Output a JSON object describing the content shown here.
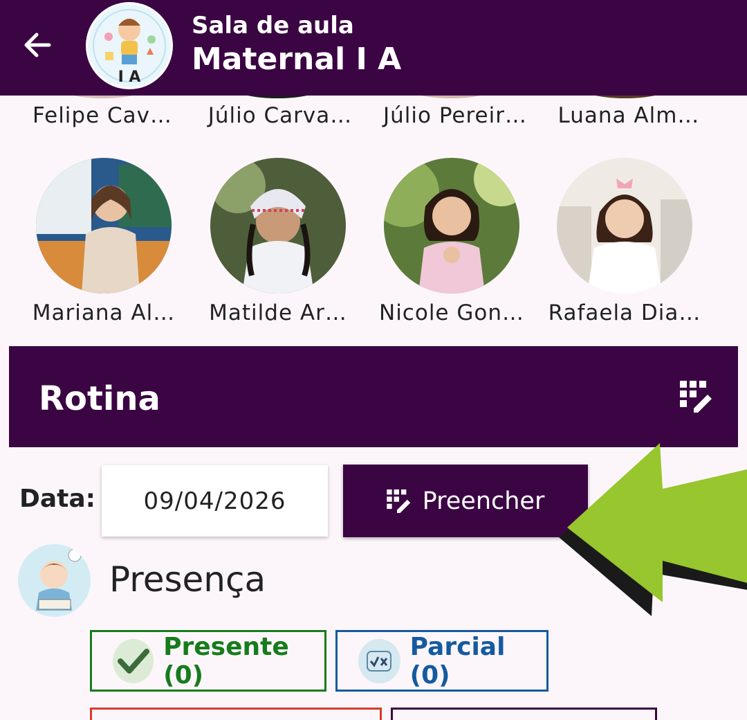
{
  "header": {
    "subtitle": "Sala de aula",
    "title": "Maternal I A",
    "avatar_text": "I A"
  },
  "students_top_row": [
    {
      "name": "Felipe Cav…"
    },
    {
      "name": "Júlio Carva…"
    },
    {
      "name": "Júlio Pereir…"
    },
    {
      "name": "Luana Alm…"
    }
  ],
  "students": [
    {
      "name": "Mariana Al…"
    },
    {
      "name": "Matilde Ar…"
    },
    {
      "name": "Nicole Gon…"
    },
    {
      "name": "Rafaela Dia…"
    }
  ],
  "rotina": {
    "title": "Rotina"
  },
  "date": {
    "label": "Data:",
    "value": "09/04/2026"
  },
  "fill_button": {
    "label": "Preencher"
  },
  "presence": {
    "title": "Presença",
    "chips": [
      {
        "label": "Presente (0)",
        "color": "#167c1c"
      },
      {
        "label": "Parcial (0)",
        "color": "#155aa0"
      }
    ],
    "next_row_colors": [
      "#d93a2e",
      "#3b0543"
    ]
  },
  "colors": {
    "primary": "#3b0543",
    "background": "#fcf6fa",
    "arrow": "#97c62e"
  }
}
